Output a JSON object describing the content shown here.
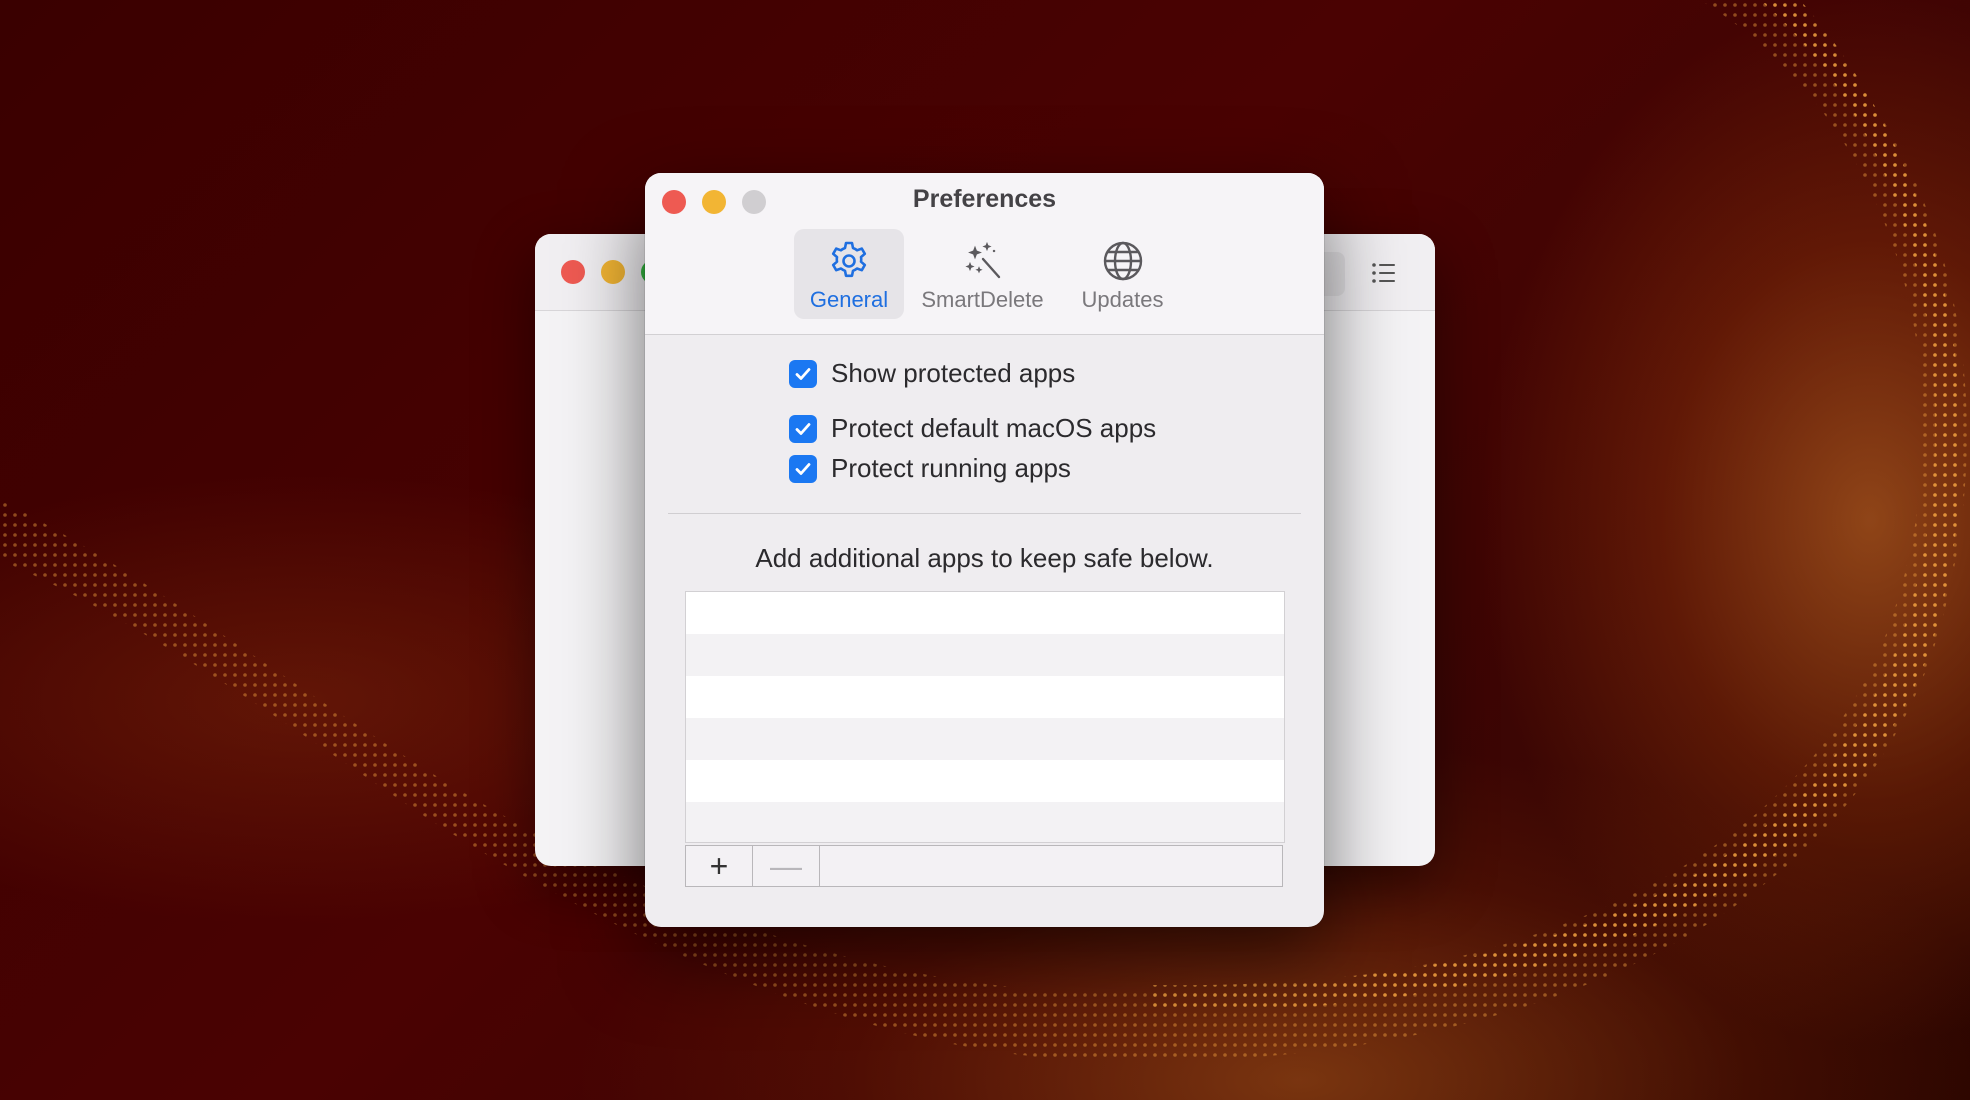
{
  "window": {
    "title": "Preferences"
  },
  "tabs": [
    {
      "label": "General",
      "icon": "gear-icon",
      "selected": true
    },
    {
      "label": "SmartDelete",
      "icon": "magic-wand-icon",
      "selected": false
    },
    {
      "label": "Updates",
      "icon": "globe-icon",
      "selected": false
    }
  ],
  "options": [
    {
      "label": "Show protected apps",
      "checked": true
    },
    {
      "label": "Protect default macOS apps",
      "checked": true
    },
    {
      "label": "Protect running apps",
      "checked": true
    }
  ],
  "safe_list": {
    "description": "Add additional apps to keep safe below.",
    "items": [],
    "add_label": "+",
    "remove_label": "—"
  },
  "colors": {
    "accent": "#1b78f2",
    "selected_tab_text": "#1f6fe0",
    "close": "#ee5a52",
    "minimize": "#f2b534",
    "zoom_inactive": "#d0ced1"
  }
}
